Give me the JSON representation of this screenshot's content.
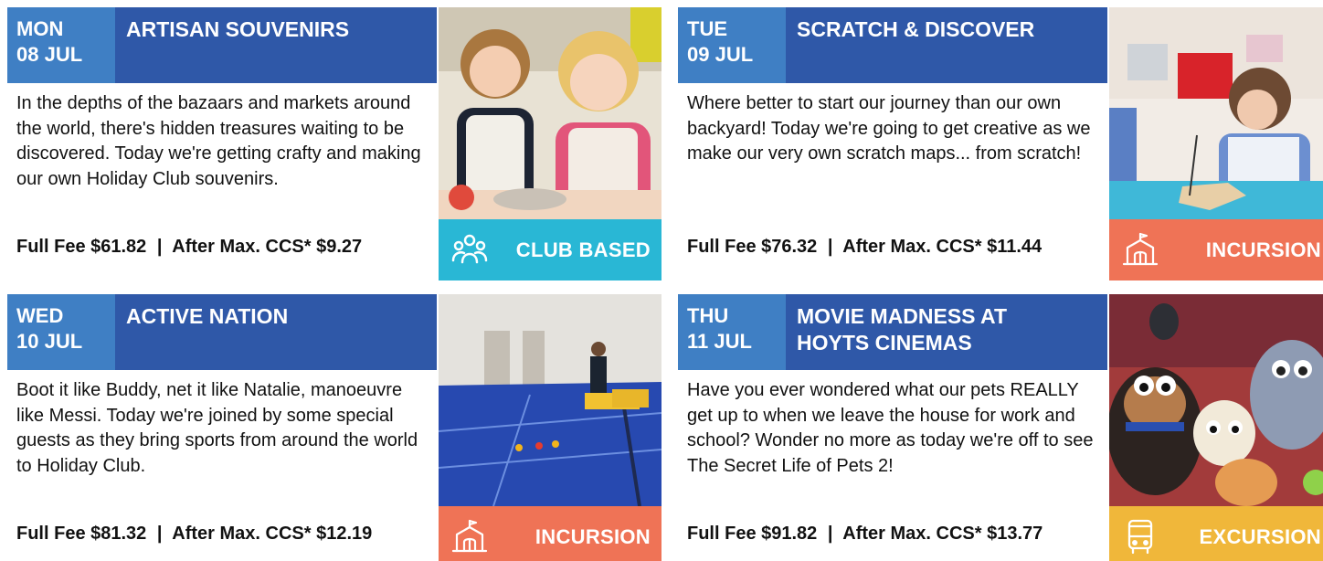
{
  "cards": [
    {
      "day": "MON",
      "date": "08 JUL",
      "title_lines": [
        "ARTISAN SOUVENIRS"
      ],
      "description": "In the depths of the bazaars and markets around the world, there's hidden treasures waiting to be discovered. Today we're getting crafty and making our own Holiday Club souvenirs.",
      "full_fee": "Full Fee $61.82",
      "separator": "|",
      "ccs_fee": "After Max. CCS* $9.27",
      "badge_label": "CLUB BASED",
      "badge_icon": "group-icon",
      "badge_color": "#29b7d5"
    },
    {
      "day": "TUE",
      "date": "09 JUL",
      "title_lines": [
        "SCRATCH & DISCOVER"
      ],
      "description": "Where better to start our journey than our own backyard! Today we're going to get creative as we make our very own scratch maps... from scratch!",
      "full_fee": "Full Fee $76.32",
      "separator": "|",
      "ccs_fee": "After Max. CCS* $11.44",
      "badge_label": "INCURSION",
      "badge_icon": "school-building-icon",
      "badge_color": "#ef7356"
    },
    {
      "day": "WED",
      "date": "10 JUL",
      "title_lines": [
        "ACTIVE NATION"
      ],
      "description": "Boot it like Buddy, net it like Natalie, manoeuvre like Messi. Today we're joined by some special guests as they bring sports from around the world to Holiday Club.",
      "full_fee": "Full Fee $81.32",
      "separator": "|",
      "ccs_fee": "After Max. CCS* $12.19",
      "badge_label": "INCURSION",
      "badge_icon": "school-building-icon",
      "badge_color": "#ef7356"
    },
    {
      "day": "THU",
      "date": "11 JUL",
      "title_lines": [
        "MOVIE MADNESS AT",
        "HOYTS CINEMAS"
      ],
      "description": "Have you ever wondered what our pets REALLY get up to when we leave the house for work and school? Wonder no more as today we're off to see The Secret Life of Pets 2!",
      "full_fee": "Full Fee $91.82",
      "separator": "|",
      "ccs_fee": "After Max. CCS* $13.77",
      "badge_label": "EXCURSION",
      "badge_icon": "bus-icon",
      "badge_color": "#f0b73a"
    }
  ],
  "colors": {
    "date_bg": "#3f7fc4",
    "title_bg": "#2f58a8"
  }
}
